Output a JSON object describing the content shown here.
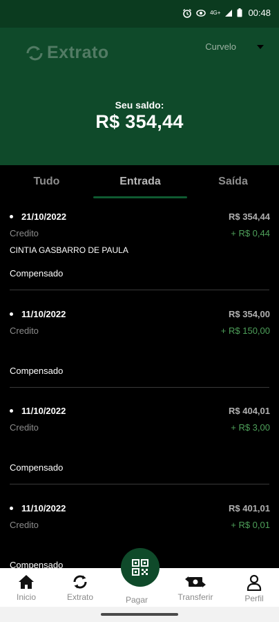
{
  "status_bar": {
    "time": "00:48",
    "network": "4G+",
    "icons": [
      "alarm-icon",
      "eye-comfort-icon",
      "signal-icon",
      "battery-icon"
    ]
  },
  "header": {
    "app_title": "Extrato",
    "city": "Curvelo",
    "balance_label": "Seu saldo:",
    "balance_value": "R$ 354,44",
    "colors": {
      "header_bg": "#0f4a2a",
      "status_bg": "#0b3b1f"
    }
  },
  "tabs": [
    {
      "label": "Tudo",
      "active": false
    },
    {
      "label": "Entrada",
      "active": true
    },
    {
      "label": "Saída",
      "active": false
    }
  ],
  "transactions": [
    {
      "date": "21/10/2022",
      "balance": "R$ 354,44",
      "type": "Credito",
      "amount": "+ R$ 0,44",
      "name": "CINTIA GASBARRO DE PAULA",
      "status": "Compensado"
    },
    {
      "date": "11/10/2022",
      "balance": "R$ 354,00",
      "type": "Credito",
      "amount": "+ R$ 150,00",
      "name": "",
      "status": "Compensado"
    },
    {
      "date": "11/10/2022",
      "balance": "R$ 404,01",
      "type": "Credito",
      "amount": "+ R$ 3,00",
      "name": "",
      "status": "Compensado"
    },
    {
      "date": "11/10/2022",
      "balance": "R$ 401,01",
      "type": "Credito",
      "amount": "+ R$ 0,01",
      "name": "",
      "status": "Compensado"
    }
  ],
  "bottom_nav": [
    {
      "label": "Inicio",
      "icon": "home-icon"
    },
    {
      "label": "Extrato",
      "icon": "refresh-icon"
    },
    {
      "label": "Pagar",
      "icon": "qr-code-icon"
    },
    {
      "label": "Transferir",
      "icon": "transfer-icon"
    },
    {
      "label": "Perfil",
      "icon": "person-icon"
    }
  ],
  "colors": {
    "credit_amount": "#4ea05a",
    "accent": "#0f4a2a"
  }
}
